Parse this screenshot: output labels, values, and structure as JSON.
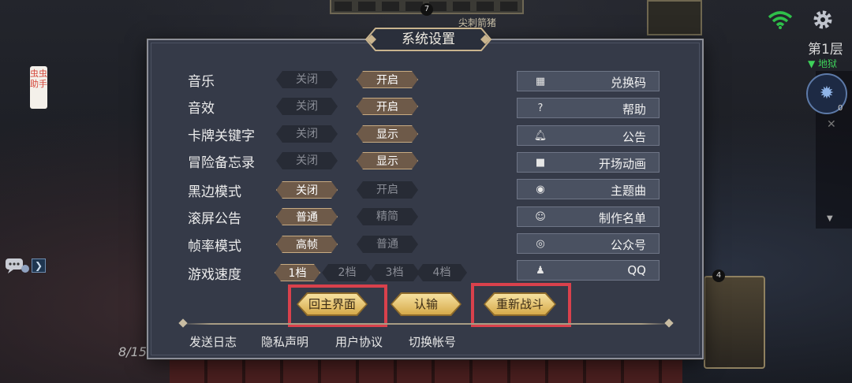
{
  "hud": {
    "top_badge": "7",
    "enemy_label": "尖刺箭猪",
    "floor": "第1层",
    "floor_sub": "▼ 地狱",
    "rail_count": "0",
    "assist_tag": "虫虫助手",
    "deck_count": "8/15",
    "right_card_count": "4"
  },
  "dialog": {
    "title": "系统设置"
  },
  "settings": [
    {
      "label": "音乐",
      "options": [
        "关闭",
        "开启"
      ],
      "selected": 1
    },
    {
      "label": "音效",
      "options": [
        "关闭",
        "开启"
      ],
      "selected": 1
    },
    {
      "label": "卡牌关键字",
      "options": [
        "关闭",
        "显示"
      ],
      "selected": 1
    },
    {
      "label": "冒险备忘录",
      "options": [
        "关闭",
        "显示"
      ],
      "selected": 1
    },
    {
      "label": "黑边模式",
      "options": [
        "关闭",
        "开启"
      ],
      "selected": 0
    },
    {
      "label": "滚屏公告",
      "options": [
        "普通",
        "精简"
      ],
      "selected": 0
    },
    {
      "label": "帧率模式",
      "options": [
        "高帧",
        "普通"
      ],
      "selected": 0
    },
    {
      "label": "游戏速度",
      "options": [
        "1档",
        "2档",
        "3档",
        "4档"
      ],
      "selected": 0
    }
  ],
  "side_buttons": [
    {
      "label": "兑换码",
      "icon": "qr-code-icon"
    },
    {
      "label": "帮助",
      "icon": "help-icon"
    },
    {
      "label": "公告",
      "icon": "bell-icon"
    },
    {
      "label": "开场动画",
      "icon": "video-camera-icon"
    },
    {
      "label": "主题曲",
      "icon": "music-disc-icon"
    },
    {
      "label": "制作名单",
      "icon": "staff-face-icon"
    },
    {
      "label": "公众号",
      "icon": "wechat-icon"
    },
    {
      "label": "QQ",
      "icon": "qq-penguin-icon"
    }
  ],
  "actions": {
    "main_menu": "回主界面",
    "surrender": "认输",
    "restart": "重新战斗"
  },
  "footer": {
    "send_log": "发送日志",
    "privacy": "隐私声明",
    "user_agreement": "用户协议",
    "switch_account": "切换帐号"
  },
  "colors": {
    "highlight": "#d9414c",
    "selected_option": "#6e5a49",
    "action_gold": "#e8c46c",
    "floor_green": "#3ed15a"
  }
}
